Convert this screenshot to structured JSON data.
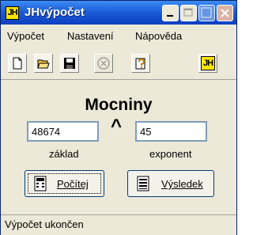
{
  "window": {
    "title": "JHvýpočet",
    "icon_text": "JH"
  },
  "titlebar_buttons": [
    "minimize-icon",
    "maximize-icon",
    "help-icon",
    "close-icon"
  ],
  "menu": {
    "items": [
      {
        "label": "Výpočet"
      },
      {
        "label": "Nastavení"
      },
      {
        "label": "Nápověda"
      }
    ]
  },
  "toolbar": {
    "tools": [
      "new-file-icon",
      "open-folder-icon",
      "save-icon",
      "cancel-icon",
      "help-icon",
      "about-icon"
    ],
    "about_text": "JH"
  },
  "main": {
    "heading": "Mocniny",
    "operator": "^",
    "base": {
      "value": "48674",
      "label": "základ"
    },
    "exponent": {
      "value": "45",
      "label": "exponent"
    }
  },
  "buttons": {
    "compute": "Počítej",
    "result": "Výsledek"
  },
  "status": {
    "text": "Výpočet ukončen"
  },
  "colors": {
    "titlebar": "#1e5ed8",
    "window_bg": "#ece9d8",
    "icon_yellow": "#ffe600"
  }
}
